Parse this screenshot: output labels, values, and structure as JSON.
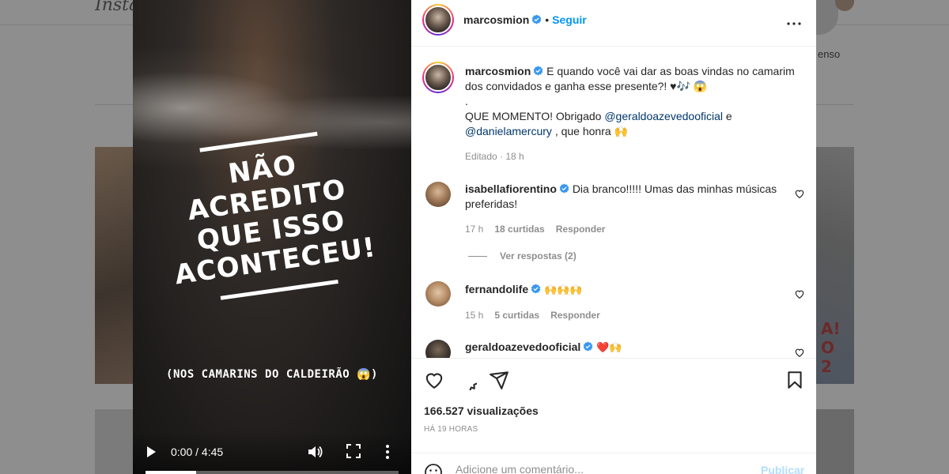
{
  "background": {
    "logo_text": "Insta",
    "suggested_username": "enso"
  },
  "video": {
    "headline": "NÃO ACREDITO QUE ISSO ACONTECEU!",
    "caption": "(NOS CAMARINS DO CALDEIRÃO 😱)",
    "time": "0:00 / 4:45",
    "progress_fraction": 0.2
  },
  "post": {
    "username": "marcosmion",
    "follow_label": "Seguir",
    "dot": "•",
    "caption": {
      "username": "marcosmion",
      "line1": "E quando você vai dar as boas vindas no camarim dos convidados e ganha esse presente?! ♥🎶 😱",
      "line2": ".",
      "line3_prefix": "QUE MOMENTO! Obrigado ",
      "mention1": "@geraldoazevedooficial",
      "line3_mid": " e",
      "mention2": "@danielamercury",
      "line3_suffix": ", que honra 🙌",
      "meta": "Editado · 18 h"
    },
    "comments": [
      {
        "username": "isabellafiorentino",
        "text": "Dia branco!!!!! Umas das minhas músicas preferidas!",
        "time": "17 h",
        "likes": "18 curtidas",
        "reply_label": "Responder",
        "view_replies": "Ver respostas (2)"
      },
      {
        "username": "fernandolife",
        "text": "🙌🙌🙌",
        "time": "15 h",
        "likes": "5 curtidas",
        "reply_label": "Responder"
      },
      {
        "username": "geraldoazevedooficial",
        "text": "❤️🙌"
      }
    ],
    "views": "166.527 visualizações",
    "posted_ago": "HÁ 19 HORAS",
    "comment_placeholder": "Adicione um comentário...",
    "publish_label": "Publicar"
  },
  "colors": {
    "accent_blue": "#0095f6",
    "link_blue": "#00376b",
    "muted_gray": "#8e8e8e",
    "verified_blue": "#3897f0"
  }
}
